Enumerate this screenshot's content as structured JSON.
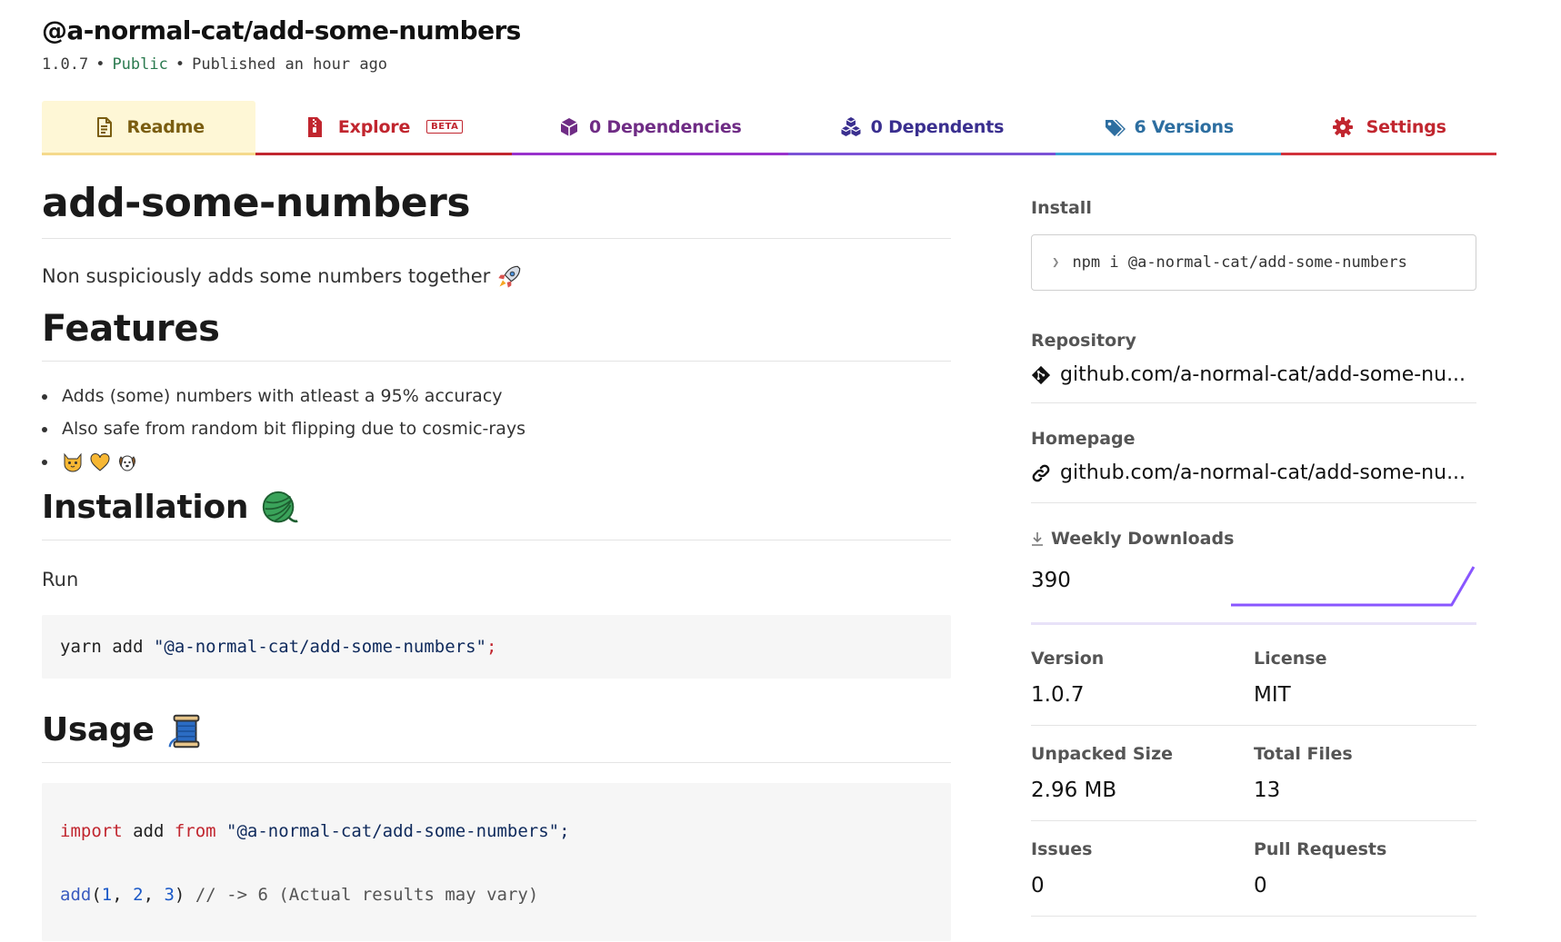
{
  "package": {
    "name": "@a-normal-cat/add-some-numbers",
    "version": "1.0.7",
    "visibility": "Public",
    "published": "Published an hour ago",
    "separator": "•"
  },
  "tabs": [
    {
      "label": "Readme",
      "icon": "readme-icon",
      "color": "#7a5d10"
    },
    {
      "label": "Explore",
      "badge": "BETA",
      "icon": "zip-file-icon",
      "color": "#c1262f"
    },
    {
      "label": "0 Dependencies",
      "icon": "box-icon",
      "color": "#6f2c85"
    },
    {
      "label": "0 Dependents",
      "icon": "boxes-icon",
      "color": "#3a2f8f"
    },
    {
      "label": "6 Versions",
      "icon": "tags-icon",
      "color": "#2d6ea0"
    },
    {
      "label": "Settings",
      "icon": "gear-icon",
      "color": "#c1262f"
    }
  ],
  "readme": {
    "title": "add-some-numbers",
    "description": "Non suspiciously adds some numbers together",
    "description_icon": "rocket-icon",
    "features_heading": "Features",
    "features": [
      "Adds (some) numbers with atleast a 95% accuracy",
      "Also safe from random bit flipping due to cosmic-rays"
    ],
    "feature_icons": [
      "cat-face-icon",
      "heart-icon",
      "dog-face-icon"
    ],
    "installation_heading": "Installation",
    "installation_icon": "yarn-ball-icon",
    "run_text": "Run",
    "install_code": {
      "cmd": "yarn add ",
      "pkg": "\"@a-normal-cat/add-some-numbers\"",
      "semi": ";"
    },
    "usage_heading": "Usage",
    "usage_icon": "thread-spool-icon",
    "usage_code": {
      "kw_import": "import",
      "name": " add ",
      "kw_from": "from",
      "pkg": " \"@a-normal-cat/add-some-numbers\";",
      "fn": "add",
      "paren_open": "(",
      "n1": "1",
      "comma1": ", ",
      "n2": "2",
      "comma2": ", ",
      "n3": "3",
      "paren_close": ")",
      "comment": " // -> 6 (Actual results may vary)"
    }
  },
  "sidebar": {
    "install_label": "Install",
    "install_cmd": "npm i @a-normal-cat/add-some-numbers",
    "repository_label": "Repository",
    "repository_link": "github.com/a-normal-cat/add-some-nu...",
    "homepage_label": "Homepage",
    "homepage_link": "github.com/a-normal-cat/add-some-nu...",
    "weekly_downloads_label": "Weekly Downloads",
    "weekly_downloads": "390",
    "weekly_downloads_trend": [
      0,
      0,
      0,
      0,
      0,
      0,
      0,
      0,
      0,
      0,
      0,
      390
    ],
    "version_label": "Version",
    "version": "1.0.7",
    "license_label": "License",
    "license": "MIT",
    "unpacked_size_label": "Unpacked Size",
    "unpacked_size": "2.96 MB",
    "total_files_label": "Total Files",
    "total_files": "13",
    "issues_label": "Issues",
    "issues": "0",
    "pull_requests_label": "Pull Requests",
    "pull_requests": "0"
  },
  "colors": {
    "public": "#2a7a4f",
    "sparkline": "#8956ff",
    "code_keyword": "#c1262f"
  }
}
